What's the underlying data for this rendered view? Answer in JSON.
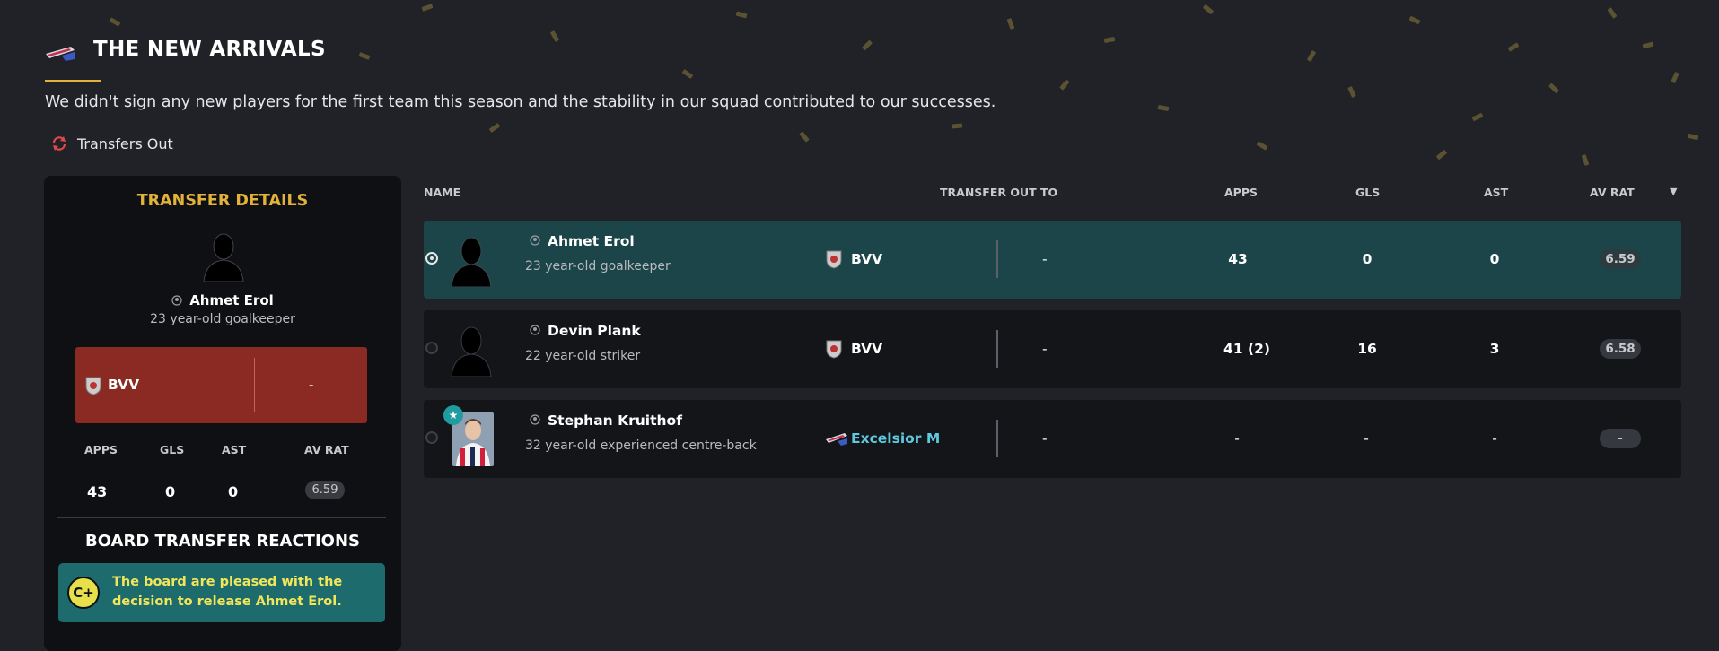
{
  "header": {
    "title": "THE NEW ARRIVALS",
    "intro": "We didn't sign any new players for the first team this season and the stability in our squad contributed to our successes.",
    "tab_label": "Transfers Out"
  },
  "details": {
    "title": "TRANSFER DETAILS",
    "player_name": "Ahmet Erol",
    "player_desc": "23 year-old goalkeeper",
    "club": "BVV",
    "fee": "-",
    "stat_headers": [
      "APPS",
      "GLS",
      "AST",
      "AV RAT"
    ],
    "stats": {
      "apps": "43",
      "gls": "0",
      "ast": "0",
      "av_rat": "6.59"
    },
    "board_title": "BOARD TRANSFER REACTIONS",
    "board_grade": "C+",
    "board_text": "The board are pleased with the decision to release Ahmet Erol."
  },
  "table": {
    "headers": {
      "name": "NAME",
      "transfer_out_to": "TRANSFER OUT TO",
      "apps": "APPS",
      "gls": "GLS",
      "ast": "AST",
      "av_rat": "AV RAT"
    },
    "rows": [
      {
        "name": "Ahmet Erol",
        "desc": "23 year-old goalkeeper",
        "club": "BVV",
        "fee": "-",
        "apps": "43",
        "gls": "0",
        "ast": "0",
        "av_rat": "6.59"
      },
      {
        "name": "Devin Plank",
        "desc": "22 year-old striker",
        "club": "BVV",
        "fee": "-",
        "apps": "41 (2)",
        "gls": "16",
        "ast": "3",
        "av_rat": "6.58"
      },
      {
        "name": "Stephan Kruithof",
        "desc": "32 year-old experienced centre-back",
        "club": "Excelsior M",
        "fee": "-",
        "apps": "-",
        "gls": "-",
        "ast": "-",
        "av_rat": "-"
      }
    ]
  },
  "icons": {
    "club_logo": "excelsior-logo-icon",
    "tab": "transfer-cycle-icon",
    "person": "person-icon",
    "star": "star-icon",
    "sort": "sort-down-icon"
  },
  "colors": {
    "accent": "#e2b23a",
    "selected_row": "#1b4549",
    "club_card": "#8b2a22",
    "board_box": "#1d6b6c",
    "grade": "#e8e04a",
    "link": "#5ec9e0"
  }
}
